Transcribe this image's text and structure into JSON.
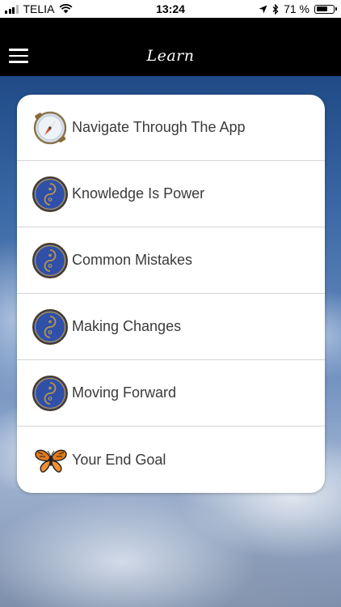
{
  "status_bar": {
    "carrier": "TELIA",
    "time": "13:24",
    "battery_text": "71 %",
    "battery_level": 0.71,
    "icons": [
      "signal-icon",
      "wifi-icon",
      "location-icon",
      "bluetooth-icon",
      "battery-icon"
    ]
  },
  "nav": {
    "title": "Learn",
    "menu_icon": "hamburger-menu-icon"
  },
  "menu": {
    "items": [
      {
        "label": "Navigate Through The App",
        "icon": "compass-icon"
      },
      {
        "label": "Knowledge Is Power",
        "icon": "yin-yang-icon"
      },
      {
        "label": "Common Mistakes",
        "icon": "yin-yang-icon"
      },
      {
        "label": "Making Changes",
        "icon": "yin-yang-icon"
      },
      {
        "label": "Moving Forward",
        "icon": "yin-yang-icon"
      },
      {
        "label": "Your End Goal",
        "icon": "butterfly-icon"
      }
    ]
  },
  "colors": {
    "nav_background": "#000000",
    "card_background": "#ffffff",
    "text": "#3a3a3a",
    "icon_blue": "#2f4fa8",
    "icon_gold": "#b8964a"
  }
}
